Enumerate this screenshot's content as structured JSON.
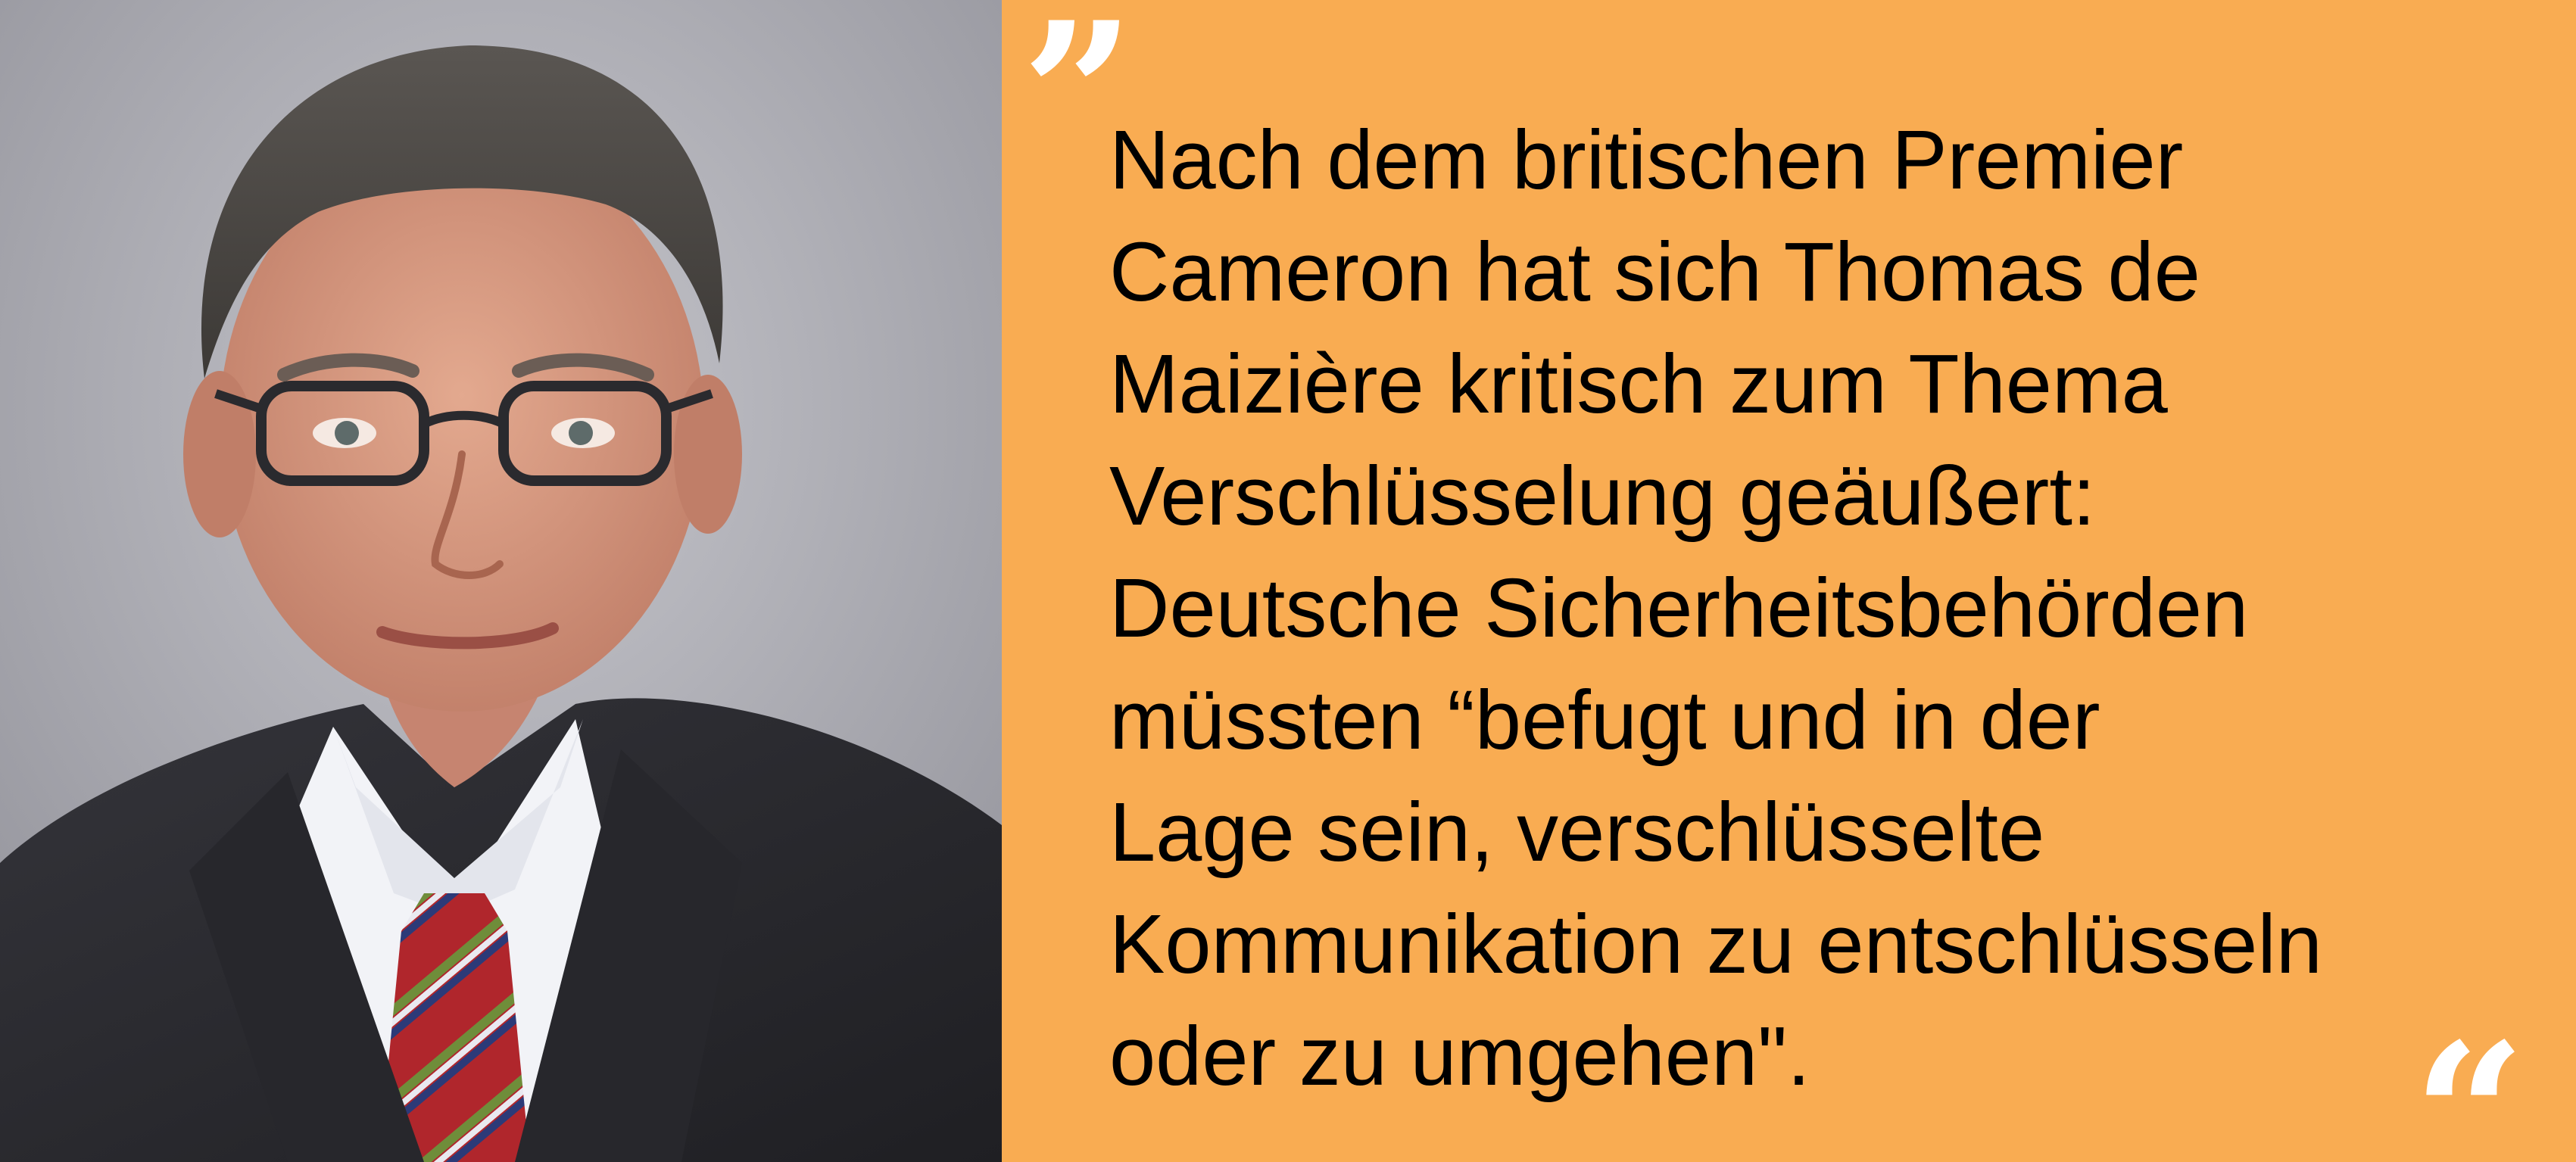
{
  "photo": {
    "icon": "portrait-photo",
    "background_color": "#9c9ca4",
    "suit_color": "#2b2b30",
    "shirt_color": "#f2f3f7",
    "tie_color": "#b0262c"
  },
  "quote": {
    "background_color": "#f9ac52",
    "text_color": "#000000",
    "mark_color": "#ffffff",
    "open_mark": "”",
    "close_mark": "“",
    "lines": [
      "Nach dem britischen Premier",
      "Cameron hat sich Thomas de",
      "Maizière kritisch zum Thema",
      "Verschlüsselung geäußert:",
      "Deutsche Sicherheitsbehörden",
      "müssten “befugt und in der",
      "Lage sein, verschlüsselte",
      "Kommunikation zu entschlüsseln",
      "oder zu umgehen\"."
    ]
  }
}
